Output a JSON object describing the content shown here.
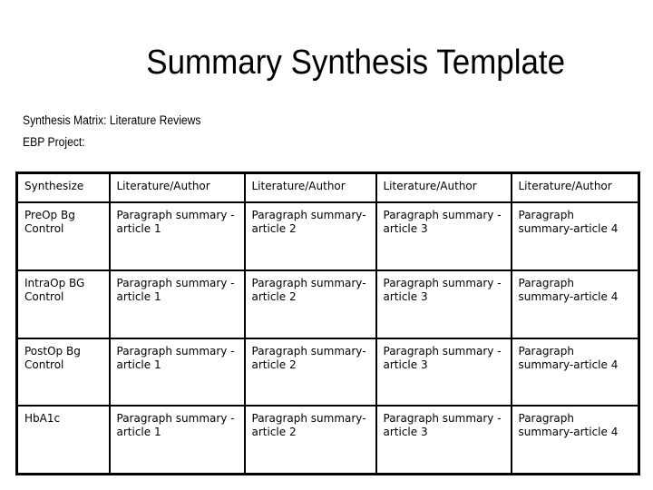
{
  "document": {
    "title": "Summary Synthesis Template",
    "subtitle_line1": "Synthesis Matrix: Literature Reviews",
    "subtitle_line2": "EBP Project:"
  },
  "table": {
    "headers": [
      "Synthesize",
      "Literature/Author",
      "Literature/Author",
      "Literature/Author",
      "Literature/Author"
    ],
    "rows": [
      {
        "topic": "PreOp Bg Control",
        "cells": [
          "Paragraph summary -article 1",
          "Paragraph summary-article 2",
          "Paragraph summary -article 3",
          "Paragraph summary-article 4"
        ]
      },
      {
        "topic": "IntraOp BG Control",
        "cells": [
          "Paragraph summary -article 1",
          "Paragraph summary-article 2",
          "Paragraph summary -article 3",
          "Paragraph summary-article 4"
        ]
      },
      {
        "topic": "PostOp Bg Control",
        "cells": [
          "Paragraph summary -article 1",
          "Paragraph summary-article 2",
          "Paragraph summary -article 3",
          "Paragraph summary-article 4"
        ]
      },
      {
        "topic": "HbA1c",
        "cells": [
          "Paragraph summary -article 1",
          "Paragraph summary-article 2",
          "Paragraph summary -article 3",
          "Paragraph summary-article 4"
        ]
      }
    ]
  }
}
